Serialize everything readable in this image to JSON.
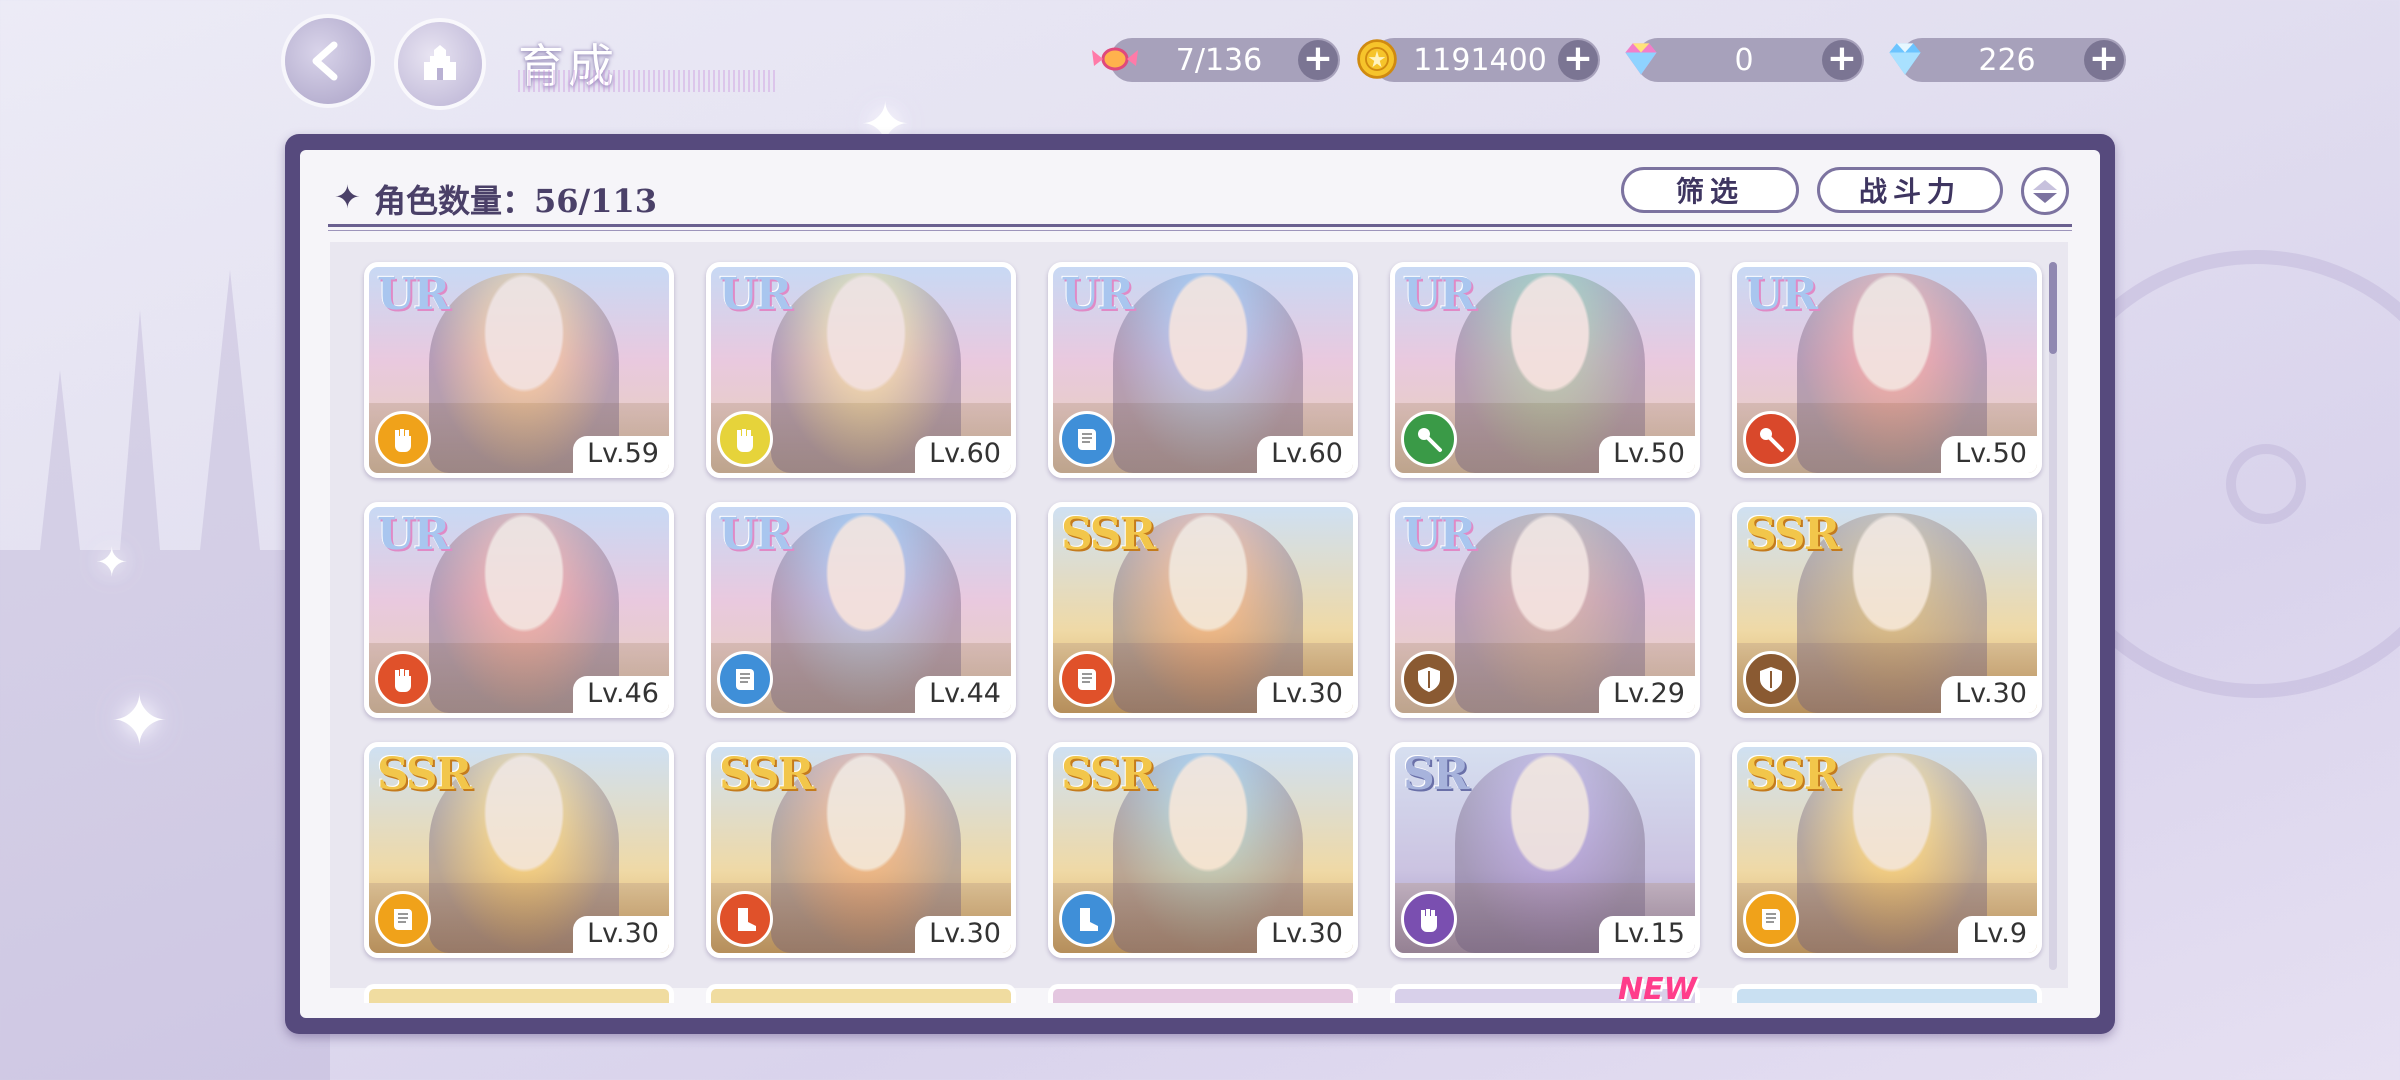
{
  "header": {
    "title": "育成",
    "resources": [
      {
        "name": "candy",
        "icon": "candy-icon",
        "value": "7/136"
      },
      {
        "name": "gold-coin",
        "icon": "coin-icon",
        "value": "1191400"
      },
      {
        "name": "rainbow-gem",
        "icon": "rainbow-gem-icon",
        "value": "0"
      },
      {
        "name": "blue-diamond",
        "icon": "diamond-icon",
        "value": "226"
      }
    ],
    "plus_label": "+"
  },
  "panel": {
    "count_label": "角色数量：56/113",
    "filter_label": "筛选",
    "sort_label": "战斗力"
  },
  "cards": [
    {
      "rarity": "UR",
      "element": "fist",
      "element_color": "#f0a21a",
      "level": "Lv.59"
    },
    {
      "rarity": "UR",
      "element": "fist",
      "element_color": "#e6d33a",
      "level": "Lv.60"
    },
    {
      "rarity": "UR",
      "element": "book",
      "element_color": "#3f8fd8",
      "level": "Lv.60"
    },
    {
      "rarity": "UR",
      "element": "wand",
      "element_color": "#3a9a47",
      "level": "Lv.50"
    },
    {
      "rarity": "UR",
      "element": "wand",
      "element_color": "#d9482b",
      "level": "Lv.50"
    },
    {
      "rarity": "UR",
      "element": "fist",
      "element_color": "#e0512a",
      "level": "Lv.46"
    },
    {
      "rarity": "UR",
      "element": "book",
      "element_color": "#3f8fd8",
      "level": "Lv.44"
    },
    {
      "rarity": "SSR",
      "element": "book",
      "element_color": "#e0512a",
      "level": "Lv.30"
    },
    {
      "rarity": "UR",
      "element": "shield",
      "element_color": "#8a5a32",
      "level": "Lv.29"
    },
    {
      "rarity": "SSR",
      "element": "shield",
      "element_color": "#8a5a32",
      "level": "Lv.30"
    },
    {
      "rarity": "SSR",
      "element": "book",
      "element_color": "#f0a21a",
      "level": "Lv.30"
    },
    {
      "rarity": "SSR",
      "element": "boot",
      "element_color": "#e0512a",
      "level": "Lv.30"
    },
    {
      "rarity": "SSR",
      "element": "boot",
      "element_color": "#3f8fd8",
      "level": "Lv.30"
    },
    {
      "rarity": "SR",
      "element": "fist",
      "element_color": "#7a4fb0",
      "level": "Lv.15"
    },
    {
      "rarity": "SSR",
      "element": "book",
      "element_color": "#f0a21a",
      "level": "Lv.9"
    }
  ],
  "new_badge": "NEW"
}
